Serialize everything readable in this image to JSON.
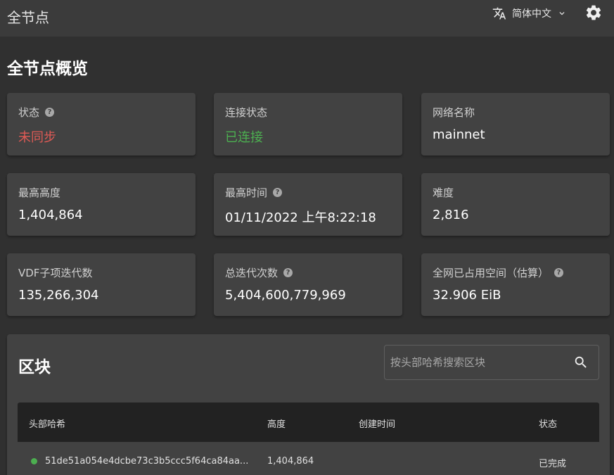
{
  "header": {
    "title": "全节点",
    "language": "简体中文",
    "icons": {
      "translate": "translate-icon",
      "chevron": "chevron-down-icon",
      "theme": "gear-icon"
    }
  },
  "page_title": "全节点概览",
  "cards": [
    {
      "label": "状态",
      "help": "?",
      "value": "未同步",
      "value_color": "#e05a55"
    },
    {
      "label": "连接状态",
      "value": "已连接",
      "value_color": "#4caf50"
    },
    {
      "label": "网络名称",
      "value": "mainnet"
    },
    {
      "label": "最高高度",
      "value": "1,404,864"
    },
    {
      "label": "最高时间",
      "help": "?",
      "value": "01/11/2022 上午8:22:18"
    },
    {
      "label": "难度",
      "value": "2,816"
    },
    {
      "label": "VDF子项迭代数",
      "value": "135,266,304"
    },
    {
      "label": "总迭代次数",
      "help": "?",
      "value": "5,404,600,779,969"
    },
    {
      "label": "全网已占用空间（估算）",
      "help": "?",
      "value": "32.906 EiB"
    }
  ],
  "blocks": {
    "title": "区块",
    "search_placeholder": "按头部哈希搜索区块",
    "columns": [
      "头部哈希",
      "高度",
      "创建时间",
      "状态"
    ],
    "rows": [
      {
        "hash": "51de51a054e4dcbe73c3b5ccc5f64ca84aa...",
        "height": "1,404,864",
        "created": "",
        "status": "已完成"
      }
    ]
  }
}
